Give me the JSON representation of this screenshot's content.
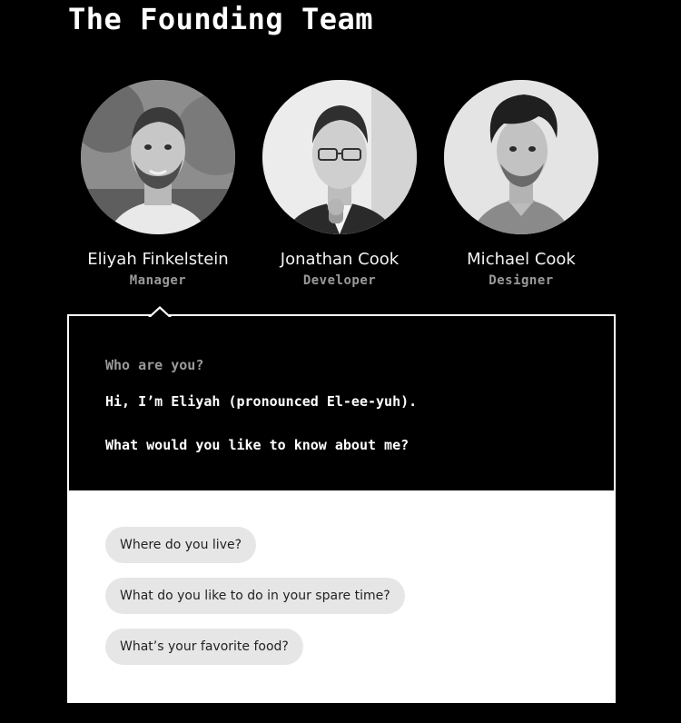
{
  "page": {
    "title": "The Founding Team"
  },
  "team": [
    {
      "name": "Eliyah Finkelstein",
      "role": "Manager"
    },
    {
      "name": "Jonathan Cook",
      "role": "Developer"
    },
    {
      "name": "Michael Cook",
      "role": "Designer"
    }
  ],
  "dialog": {
    "prompt": "Who are you?",
    "answer_lines": [
      "Hi, I’m Eliyah (pronounced El-ee-yuh).",
      "What would you like to know about me?"
    ],
    "questions": [
      "Where do you live?",
      "What do you like to do in your spare time?",
      "What’s your favorite food?"
    ]
  },
  "colors": {
    "background": "#000000",
    "text": "#ffffff",
    "muted": "#9a9a9a",
    "chip": "#e6e6e6"
  }
}
